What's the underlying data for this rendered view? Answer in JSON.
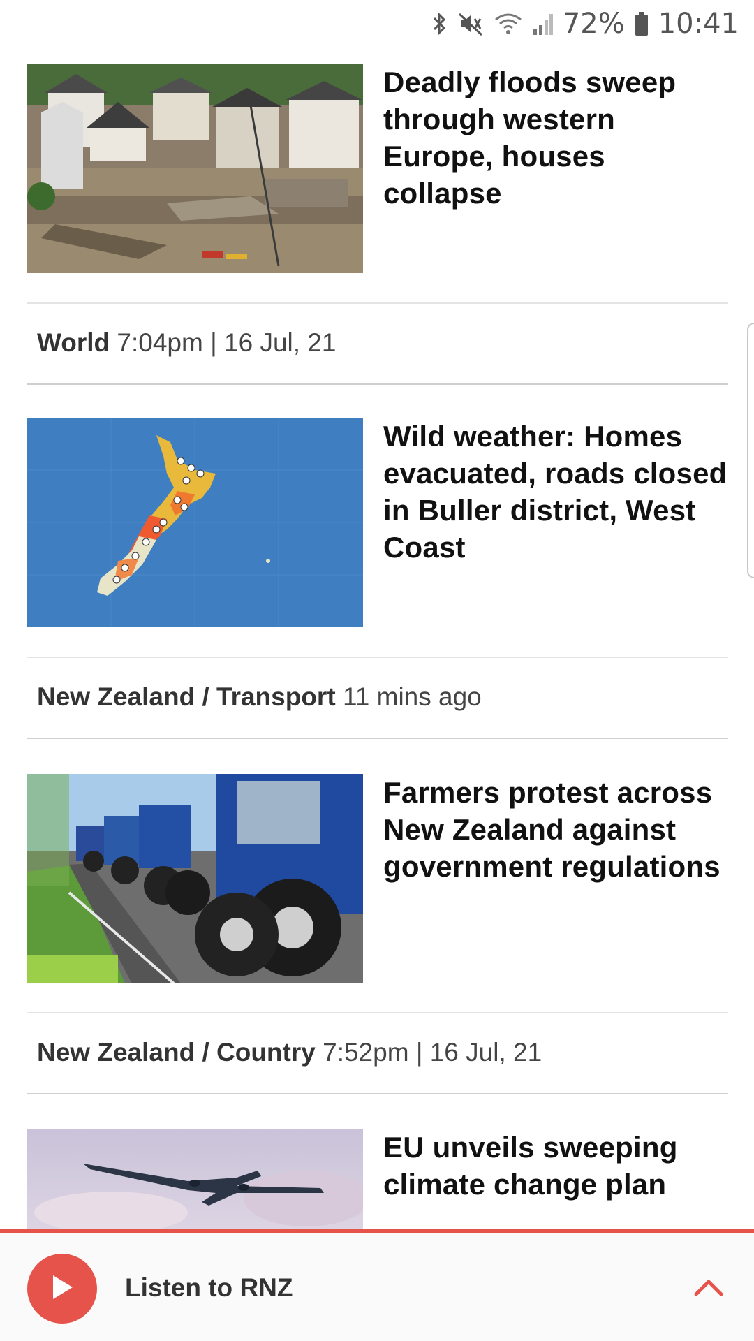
{
  "status_bar": {
    "battery": "72%",
    "time": "10:41",
    "icons": [
      "bluetooth-icon",
      "mute-icon",
      "wifi-icon",
      "signal-icon",
      "battery-icon"
    ]
  },
  "articles": [
    {
      "headline": "Deadly floods sweep through western Europe, houses collapse",
      "image": "flood-damaged-village",
      "section": "World",
      "time": "7:04pm | 16 Jul, 21"
    },
    {
      "headline": "Wild weather: Homes evacuated, roads closed in Buller district, West Coast",
      "image": "new-zealand-weather-warning-map",
      "section": "New Zealand / Transport",
      "time": "11 mins ago"
    },
    {
      "headline": "Farmers protest across New Zealand against government regulations",
      "image": "tractors-protest-convoy",
      "section": "New Zealand / Country",
      "time": "7:52pm | 16 Jul, 21"
    },
    {
      "headline": "EU unveils sweeping climate change plan",
      "image": "airplane-in-clouds"
    }
  ],
  "player": {
    "label": "Listen to RNZ",
    "accent": "#e5534b"
  }
}
